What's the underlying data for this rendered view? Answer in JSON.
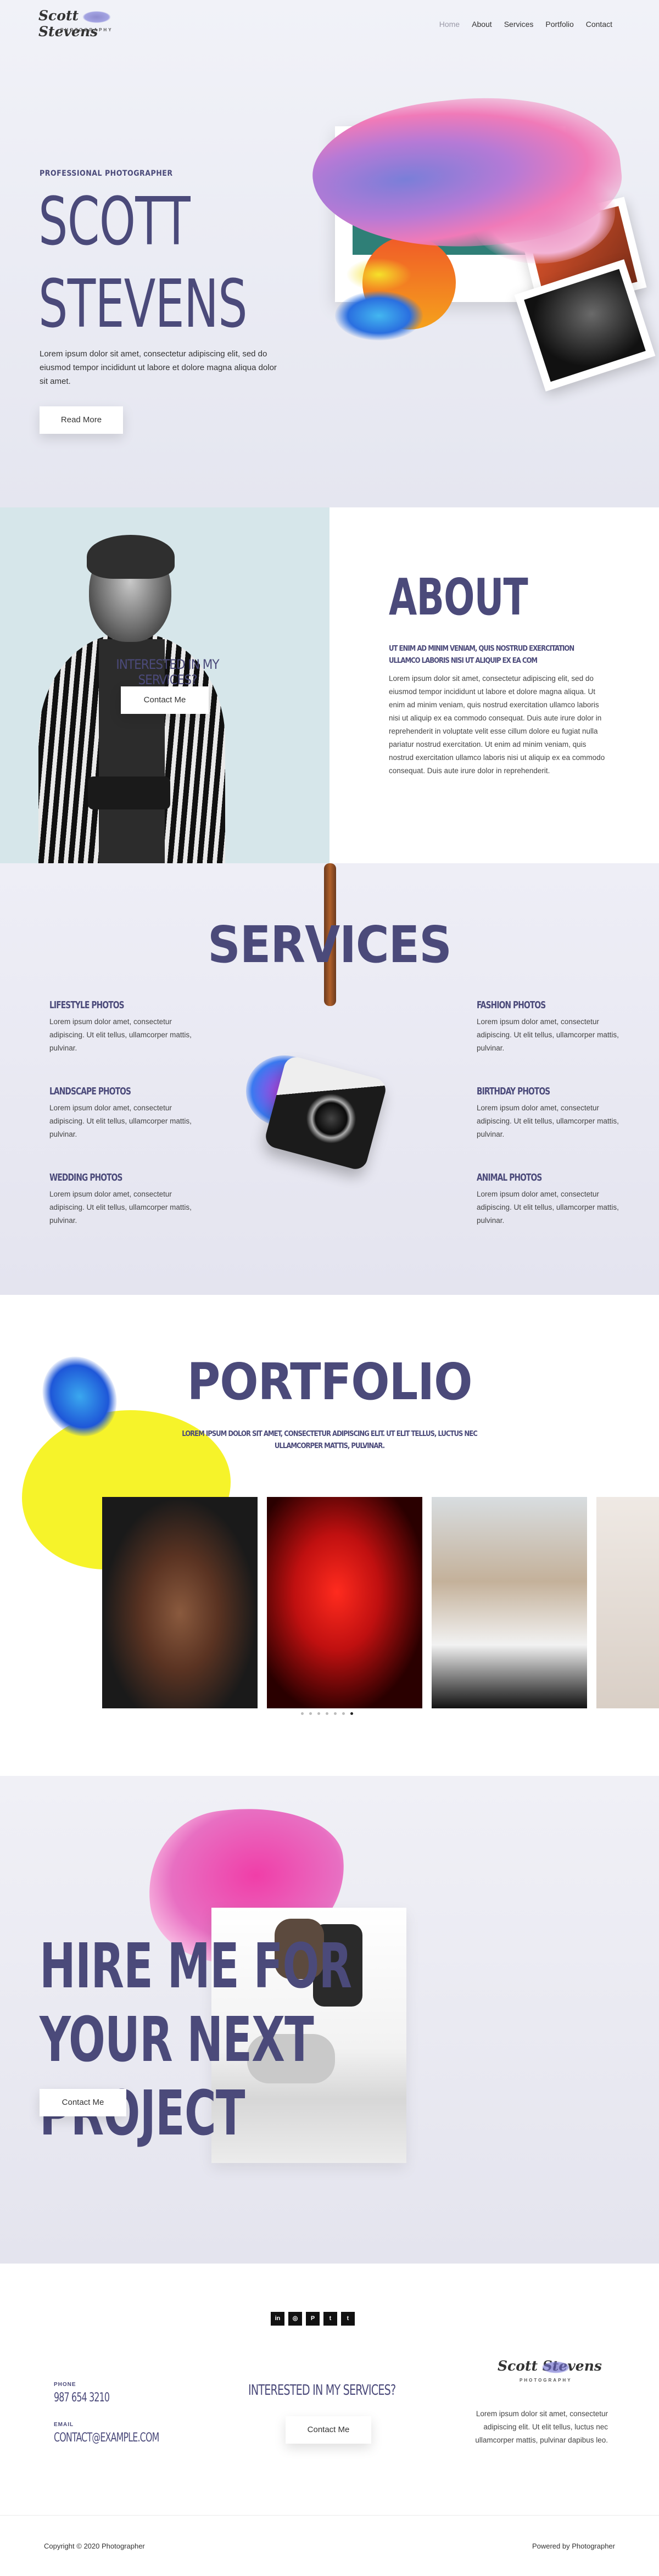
{
  "header": {
    "logo_script": "Scott Stevens",
    "logo_sub": "PHOTOGRAPHY",
    "nav": [
      "Home",
      "About",
      "Services",
      "Portfolio",
      "Contact"
    ]
  },
  "hero": {
    "pre_title": "PROFESSIONAL PHOTOGRAPHER",
    "name_line1": "SCOTT",
    "name_line2": "STEVENS",
    "body": "Lorem ipsum dolor sit amet, consectetur adipiscing elit, sed do eiusmod tempor incididunt ut labore et dolore magna aliqua dolor sit amet.",
    "button": "Read More"
  },
  "about": {
    "overlay_question": "INTERESTED IN MY SERVICES?",
    "overlay_button": "Contact Me",
    "title": "ABOUT",
    "subtitle": "UT ENIM AD MINIM VENIAM, QUIS NOSTRUD EXERCITATION ULLAMCO LABORIS NISI UT ALIQUIP EX EA COM",
    "body": "Lorem ipsum dolor sit amet, consectetur adipiscing elit, sed do eiusmod tempor incididunt ut labore et dolore magna aliqua. Ut enim ad minim veniam, quis nostrud exercitation ullamco laboris nisi ut aliquip ex ea commodo consequat. Duis aute irure dolor in reprehenderit in voluptate velit esse cillum dolore eu fugiat nulla pariatur nostrud exercitation. Ut enim ad minim veniam, quis nostrud exercitation ullamco laboris nisi ut aliquip ex ea commodo consequat. Duis aute irure dolor in reprehenderit."
  },
  "services": {
    "title": "SERVICES",
    "items": [
      {
        "title": "LIFESTYLE PHOTOS",
        "body": "Lorem ipsum dolor amet, consectetur adipiscing. Ut elit tellus, ullamcorper mattis, pulvinar."
      },
      {
        "title": "LANDSCAPE PHOTOS",
        "body": "Lorem ipsum dolor amet, consectetur adipiscing. Ut elit tellus, ullamcorper mattis, pulvinar."
      },
      {
        "title": "WEDDING PHOTOS",
        "body": "Lorem ipsum dolor amet, consectetur adipiscing. Ut elit tellus, ullamcorper mattis, pulvinar."
      },
      {
        "title": "FASHION PHOTOS",
        "body": "Lorem ipsum dolor amet, consectetur adipiscing. Ut elit tellus, ullamcorper mattis, pulvinar."
      },
      {
        "title": "BIRTHDAY PHOTOS",
        "body": "Lorem ipsum dolor amet, consectetur adipiscing. Ut elit tellus, ullamcorper mattis, pulvinar."
      },
      {
        "title": "ANIMAL PHOTOS",
        "body": "Lorem ipsum dolor amet, consectetur adipiscing. Ut elit tellus, ullamcorper mattis, pulvinar."
      }
    ]
  },
  "portfolio": {
    "title": "PORTFOLIO",
    "subtitle": "LOREM IPSUM DOLOR SIT AMET, CONSECTETUR ADIPISCING ELIT. UT ELIT TELLUS, LUCTUS NEC ULLAMCORPER MATTIS, PULVINAR.",
    "slides": [
      "portrait-woman-face-paint",
      "red-betta-fish",
      "woman-sunglasses",
      "flowers"
    ],
    "dot_count": 7,
    "active_dot": 7
  },
  "hire": {
    "title": "HIRE ME FOR YOUR NEXT PROJECT",
    "button": "Contact Me"
  },
  "footer": {
    "socials": [
      "linkedin",
      "instagram",
      "pinterest",
      "twitter",
      "tumblr"
    ],
    "social_glyphs": [
      "in",
      "◎",
      "P",
      "t",
      "t"
    ],
    "phone_label": "PHONE",
    "phone": "987 654 3210",
    "email_label": "EMAIL",
    "email": "CONTACT@EXAMPLE.COM",
    "question": "INTERESTED IN MY SERVICES?",
    "button": "Contact Me",
    "logo_script": "Scott Stevens",
    "logo_sub": "PHOTOGRAPHY",
    "body": "Lorem ipsum dolor sit amet, consectetur adipiscing elit. Ut elit tellus, luctus nec ullamcorper mattis, pulvinar dapibus leo.",
    "copyright": "Copyright © 2020 Photographer",
    "powered": "Powered by Photographer"
  },
  "colors": {
    "accent": "#4b4a7a",
    "yellow": "#f6f32a",
    "pink": "#f03ea8"
  }
}
